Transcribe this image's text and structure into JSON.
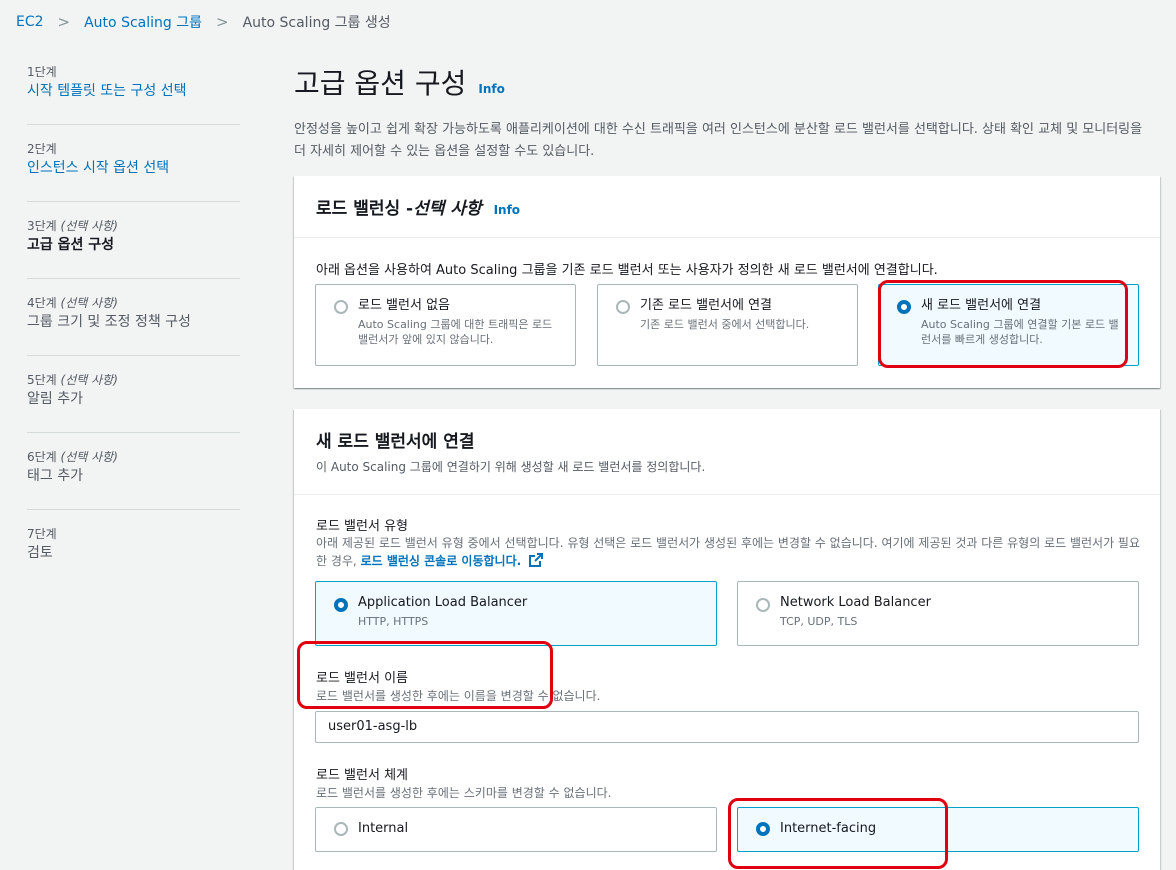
{
  "breadcrumb": {
    "items": [
      "EC2",
      "Auto Scaling 그룹"
    ],
    "current": "Auto Scaling 그룹 생성"
  },
  "sidebar": {
    "steps": [
      {
        "num": "1단계",
        "optional": "",
        "title": "시작 템플릿 또는 구성 선택",
        "state": "link"
      },
      {
        "num": "2단계",
        "optional": "",
        "title": "인스턴스 시작 옵션 선택",
        "state": "link"
      },
      {
        "num": "3단계",
        "optional": "(선택 사항)",
        "title": "고급 옵션 구성",
        "state": "active"
      },
      {
        "num": "4단계",
        "optional": "(선택 사항)",
        "title": "그룹 크기 및 조정 정책 구성",
        "state": "dim"
      },
      {
        "num": "5단계",
        "optional": "(선택 사항)",
        "title": "알림 추가",
        "state": "dim"
      },
      {
        "num": "6단계",
        "optional": "(선택 사항)",
        "title": "태그 추가",
        "state": "dim"
      },
      {
        "num": "7단계",
        "optional": "",
        "title": "검토",
        "state": "dim"
      }
    ]
  },
  "main": {
    "title": "고급 옵션 구성",
    "info": "Info",
    "description": "안정성을 높이고 쉽게 확장 가능하도록 애플리케이션에 대한 수신 트래픽을 여러 인스턴스에 분산할 로드 밸런서를 선택합니다. 상태 확인 교체 및 모니터링을 더 자세히 제어할 수 있는 옵션을 설정할 수도 있습니다."
  },
  "lb_panel": {
    "title_main": "로드 밸런싱 - ",
    "title_italic": "선택 사항",
    "info": "Info",
    "instruction": "아래 옵션을 사용하여 Auto Scaling 그룹을 기존 로드 밸런서 또는 사용자가 정의한 새 로드 밸런서에 연결합니다.",
    "options": [
      {
        "title": "로드 밸런서 없음",
        "desc": "Auto Scaling 그룹에 대한 트래픽은 로드 밸런서가 앞에 있지 않습니다."
      },
      {
        "title": "기존 로드 밸런서에 연결",
        "desc": "기존 로드 밸런서 중에서 선택합니다."
      },
      {
        "title": "새 로드 밸런서에 연결",
        "desc": "Auto Scaling 그룹에 연결할 기본 로드 밸런서를 빠르게 생성합니다."
      }
    ]
  },
  "new_lb_panel": {
    "title": "새 로드 밸런서에 연결",
    "desc": "이 Auto Scaling 그룹에 연결하기 위해 생성할 새 로드 밸런서를 정의합니다.",
    "type_label": "로드 밸런서 유형",
    "type_desc": "아래 제공된 로드 밸런서 유형 중에서 선택합니다. 유형 선택은 로드 밸런서가 생성된 후에는 변경할 수 없습니다. 여기에 제공된 것과 다른 유형의 로드 밸런서가 필요한 경우, ",
    "type_link": "로드 밸런싱 콘솔로 이동합니다.",
    "types": [
      {
        "title": "Application Load Balancer",
        "desc": "HTTP, HTTPS"
      },
      {
        "title": "Network Load Balancer",
        "desc": "TCP, UDP, TLS"
      }
    ],
    "name_label": "로드 밸런서 이름",
    "name_desc": "로드 밸런서를 생성한 후에는 이름을 변경할 수 없습니다.",
    "name_value": "user01-asg-lb",
    "scheme_label": "로드 밸런서 체계",
    "scheme_desc": "로드 밸런서를 생성한 후에는 스키마를 변경할 수 없습니다.",
    "schemes": [
      {
        "title": "Internal"
      },
      {
        "title": "Internet-facing"
      }
    ]
  }
}
